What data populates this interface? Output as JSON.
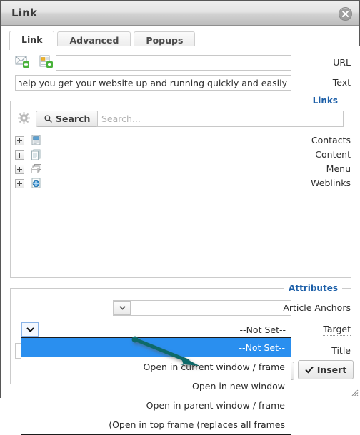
{
  "window": {
    "title": "Link",
    "close_icon": "close-circle-icon"
  },
  "tabs": [
    {
      "label": "Link",
      "active": true
    },
    {
      "label": "Advanced",
      "active": false
    },
    {
      "label": "Popups",
      "active": false
    }
  ],
  "fields": {
    "url": {
      "label": "URL",
      "value": "",
      "placeholder": "",
      "email_icon": "mail-add-icon",
      "article_icon": "document-add-icon"
    },
    "text": {
      "label": "Text",
      "value": "mla will help you get your website up and running quickly and easily"
    }
  },
  "links_section": {
    "legend": "Links",
    "gear_icon": "gear-icon",
    "search_button": {
      "label": "Search",
      "icon": "magnifier-icon"
    },
    "search_input": {
      "value": "",
      "placeholder": "...Search"
    },
    "tree": [
      {
        "label": "Contacts",
        "icon": "contact-card-icon",
        "expander": "plus-icon"
      },
      {
        "label": "Content",
        "icon": "content-pages-icon",
        "expander": "plus-icon"
      },
      {
        "label": "Menu",
        "icon": "menu-windows-icon",
        "expander": "plus-icon"
      },
      {
        "label": "Weblinks",
        "icon": "weblink-globe-icon",
        "expander": "plus-icon"
      }
    ]
  },
  "attributes_section": {
    "legend": "Attributes",
    "article_anchors": {
      "label": "Article Anchors",
      "value": "---"
    },
    "target": {
      "label": "Target",
      "value": "--Not Set--",
      "open": true,
      "options": [
        "--Not Set--",
        "Open in current window / frame",
        "Open in new window",
        "Open in parent window / frame",
        "(Open in top frame (replaces all frames"
      ],
      "selected_index": 0
    },
    "title": {
      "label": "Title",
      "value": ""
    }
  },
  "footer": {
    "insert_button": {
      "label": "Insert",
      "icon": "check-icon"
    },
    "resize_grip": "resize-grip-icon"
  },
  "annotation": {
    "arrow_color": "#0d6b6b",
    "points_to": "Open in new window"
  },
  "colors": {
    "legend_blue": "#1c5fa8",
    "highlight_blue": "#2a8fef",
    "arrow_teal": "#0d6b6b"
  }
}
